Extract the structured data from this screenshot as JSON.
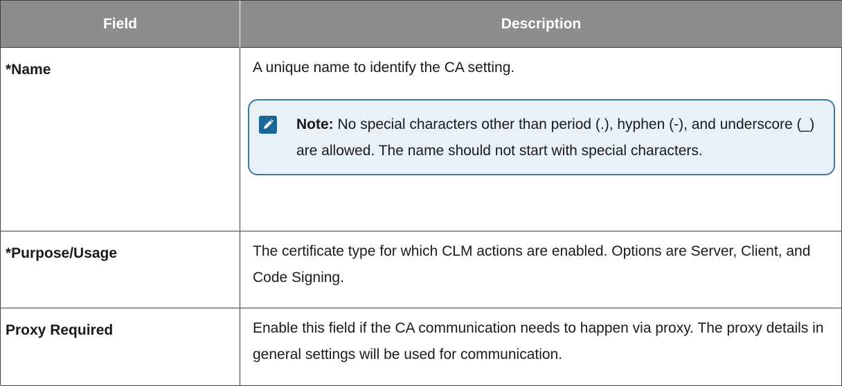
{
  "table": {
    "headers": [
      "Field",
      "Description"
    ],
    "rows": [
      {
        "field": "*Name",
        "description": "A unique name to identify the CA setting.",
        "note": {
          "label": "Note:",
          "text": "No special characters other than period (.), hyphen (-), and underscore (_) are allowed. The name should not start with special characters."
        }
      },
      {
        "field": "*Purpose/Usage",
        "description": "The certificate type for which CLM actions are enabled. Options are Server, Client, and Code Signing."
      },
      {
        "field": "Proxy Required",
        "description": "Enable this field if the CA communication needs to happen via proxy. The proxy details in general settings will be used for communication."
      }
    ]
  },
  "colors": {
    "header_bg": "#8d8d8d",
    "note_border": "#3c7aa1",
    "note_bg": "#e8f1f8",
    "note_icon": "#1b6799"
  },
  "icons": {
    "note": "pencil-icon"
  }
}
